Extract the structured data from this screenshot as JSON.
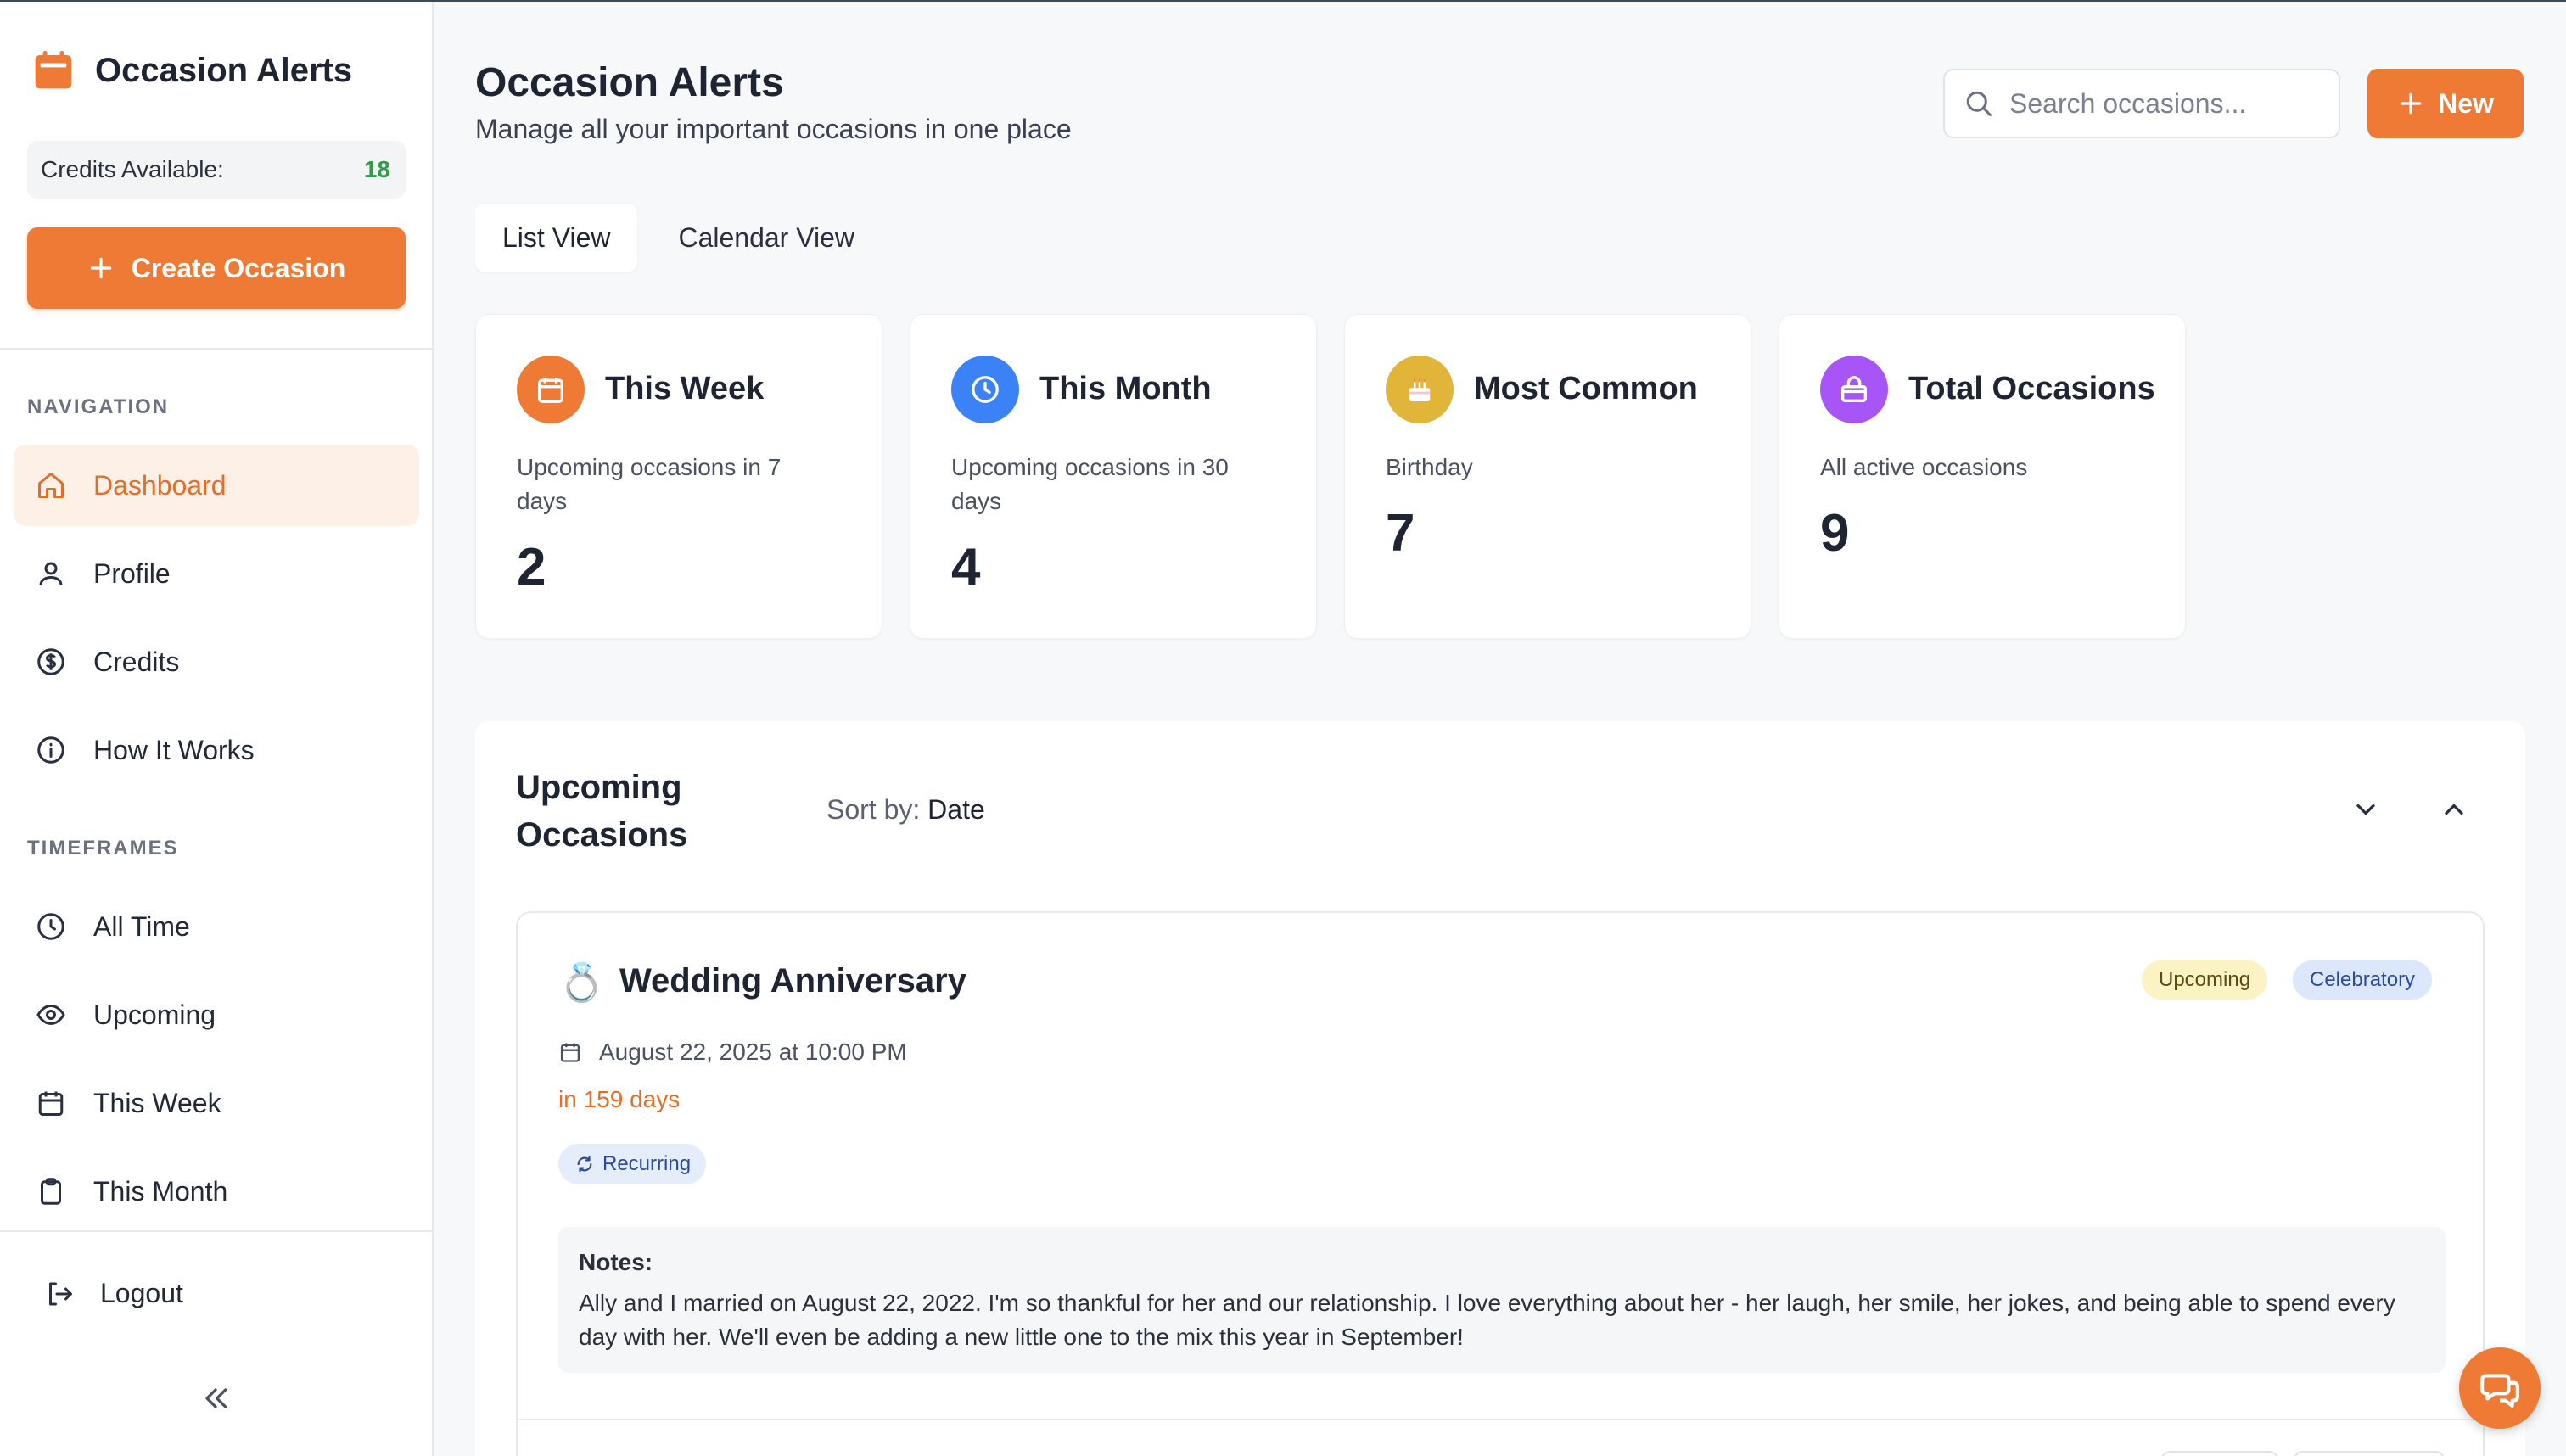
{
  "app": {
    "title": "Occasion Alerts",
    "accent_color": "#ee7a35"
  },
  "sidebar": {
    "brand_icon": "calendar-icon",
    "credits_label": "Credits Available:",
    "credits_value": "18",
    "create_label": "Create Occasion",
    "nav_section": "NAVIGATION",
    "nav_items": [
      {
        "label": "Dashboard",
        "icon": "home-icon",
        "active": true
      },
      {
        "label": "Profile",
        "icon": "user-icon",
        "active": false
      },
      {
        "label": "Credits",
        "icon": "dollar-circle-icon",
        "active": false
      },
      {
        "label": "How It Works",
        "icon": "info-icon",
        "active": false
      }
    ],
    "timeframes_section": "TIMEFRAMES",
    "timeframe_items": [
      {
        "label": "All Time",
        "icon": "clock-icon"
      },
      {
        "label": "Upcoming",
        "icon": "eye-icon"
      },
      {
        "label": "This Week",
        "icon": "calendar-icon"
      },
      {
        "label": "This Month",
        "icon": "clipboard-icon"
      }
    ],
    "logout_label": "Logout",
    "collapse_icon": "double-chevron-left-icon"
  },
  "header": {
    "title": "Occasion Alerts",
    "subtitle": "Manage all your important occasions in one place",
    "search_placeholder": "Search occasions...",
    "new_label": "New"
  },
  "tabs": [
    {
      "label": "List View",
      "active": true
    },
    {
      "label": "Calendar View",
      "active": false
    }
  ],
  "stats": [
    {
      "title": "This Week",
      "desc": "Upcoming occasions in 7 days",
      "value": "2",
      "icon": "calendar-icon",
      "color": "#ee7a35"
    },
    {
      "title": "This Month",
      "desc": "Upcoming occasions in 30 days",
      "value": "4",
      "icon": "clock-icon",
      "color": "#3b82f6"
    },
    {
      "title": "Most Common",
      "desc": "Birthday",
      "value": "7",
      "icon": "cake-icon",
      "color": "#e0b53a"
    },
    {
      "title": "Total Occasions",
      "desc": "All active occasions",
      "value": "9",
      "icon": "gift-icon",
      "color": "#a855f7"
    }
  ],
  "upcoming": {
    "title": "Upcoming Occasions",
    "sort_label": "Sort by:",
    "sort_value": "Date",
    "occasion": {
      "emoji": "💍",
      "title": "Wedding Anniversary",
      "badges": [
        "Upcoming",
        "Celebratory"
      ],
      "date": "August 22, 2025 at 10:00 PM",
      "relative": "in 159 days",
      "recurring_label": "Recurring",
      "notes_label": "Notes:",
      "notes_text": "Ally and I married on August 22, 2022. I'm so thankful for her and our relationship. I love everything about her - her laugh, her smile, her jokes, and being able to spend every day with her. We'll even be adding a new little one to the mix this year in September!"
    }
  },
  "chat_icon": "chat-bubbles-icon"
}
